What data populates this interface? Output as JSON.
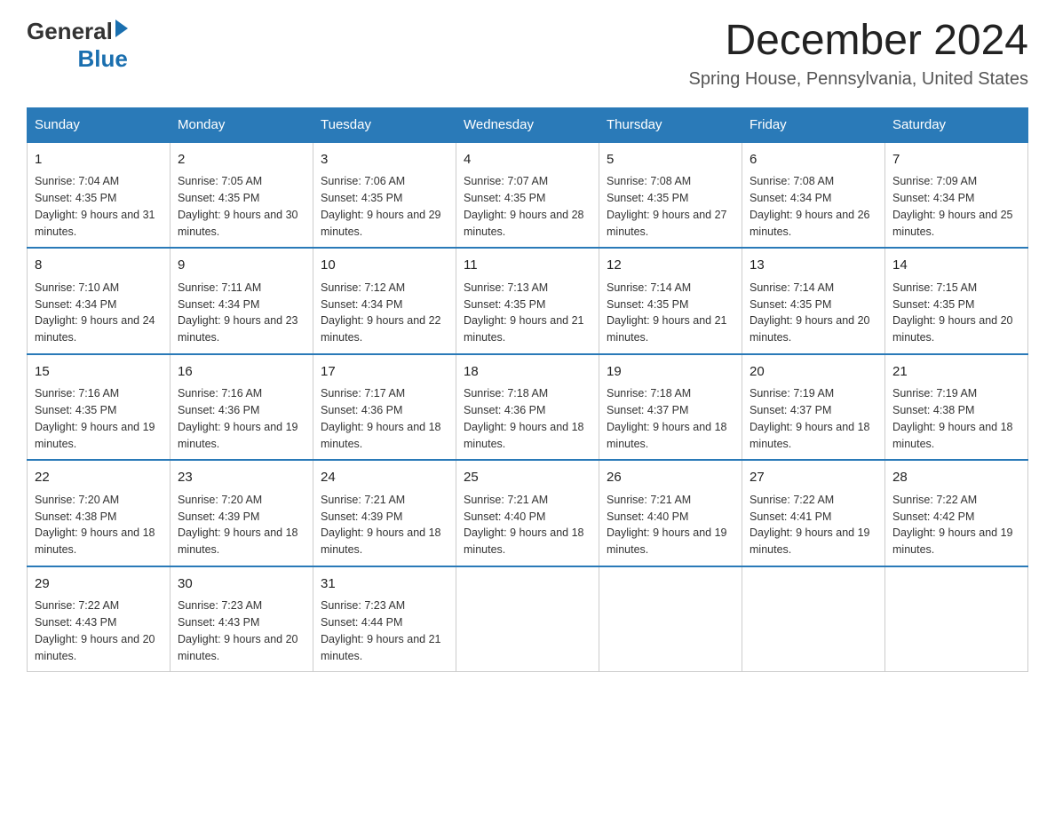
{
  "logo": {
    "general": "General",
    "blue": "Blue"
  },
  "header": {
    "month": "December 2024",
    "location": "Spring House, Pennsylvania, United States"
  },
  "weekdays": [
    "Sunday",
    "Monday",
    "Tuesday",
    "Wednesday",
    "Thursday",
    "Friday",
    "Saturday"
  ],
  "weeks": [
    [
      {
        "day": "1",
        "sunrise": "7:04 AM",
        "sunset": "4:35 PM",
        "daylight": "9 hours and 31 minutes."
      },
      {
        "day": "2",
        "sunrise": "7:05 AM",
        "sunset": "4:35 PM",
        "daylight": "9 hours and 30 minutes."
      },
      {
        "day": "3",
        "sunrise": "7:06 AM",
        "sunset": "4:35 PM",
        "daylight": "9 hours and 29 minutes."
      },
      {
        "day": "4",
        "sunrise": "7:07 AM",
        "sunset": "4:35 PM",
        "daylight": "9 hours and 28 minutes."
      },
      {
        "day": "5",
        "sunrise": "7:08 AM",
        "sunset": "4:35 PM",
        "daylight": "9 hours and 27 minutes."
      },
      {
        "day": "6",
        "sunrise": "7:08 AM",
        "sunset": "4:34 PM",
        "daylight": "9 hours and 26 minutes."
      },
      {
        "day": "7",
        "sunrise": "7:09 AM",
        "sunset": "4:34 PM",
        "daylight": "9 hours and 25 minutes."
      }
    ],
    [
      {
        "day": "8",
        "sunrise": "7:10 AM",
        "sunset": "4:34 PM",
        "daylight": "9 hours and 24 minutes."
      },
      {
        "day": "9",
        "sunrise": "7:11 AM",
        "sunset": "4:34 PM",
        "daylight": "9 hours and 23 minutes."
      },
      {
        "day": "10",
        "sunrise": "7:12 AM",
        "sunset": "4:34 PM",
        "daylight": "9 hours and 22 minutes."
      },
      {
        "day": "11",
        "sunrise": "7:13 AM",
        "sunset": "4:35 PM",
        "daylight": "9 hours and 21 minutes."
      },
      {
        "day": "12",
        "sunrise": "7:14 AM",
        "sunset": "4:35 PM",
        "daylight": "9 hours and 21 minutes."
      },
      {
        "day": "13",
        "sunrise": "7:14 AM",
        "sunset": "4:35 PM",
        "daylight": "9 hours and 20 minutes."
      },
      {
        "day": "14",
        "sunrise": "7:15 AM",
        "sunset": "4:35 PM",
        "daylight": "9 hours and 20 minutes."
      }
    ],
    [
      {
        "day": "15",
        "sunrise": "7:16 AM",
        "sunset": "4:35 PM",
        "daylight": "9 hours and 19 minutes."
      },
      {
        "day": "16",
        "sunrise": "7:16 AM",
        "sunset": "4:36 PM",
        "daylight": "9 hours and 19 minutes."
      },
      {
        "day": "17",
        "sunrise": "7:17 AM",
        "sunset": "4:36 PM",
        "daylight": "9 hours and 18 minutes."
      },
      {
        "day": "18",
        "sunrise": "7:18 AM",
        "sunset": "4:36 PM",
        "daylight": "9 hours and 18 minutes."
      },
      {
        "day": "19",
        "sunrise": "7:18 AM",
        "sunset": "4:37 PM",
        "daylight": "9 hours and 18 minutes."
      },
      {
        "day": "20",
        "sunrise": "7:19 AM",
        "sunset": "4:37 PM",
        "daylight": "9 hours and 18 minutes."
      },
      {
        "day": "21",
        "sunrise": "7:19 AM",
        "sunset": "4:38 PM",
        "daylight": "9 hours and 18 minutes."
      }
    ],
    [
      {
        "day": "22",
        "sunrise": "7:20 AM",
        "sunset": "4:38 PM",
        "daylight": "9 hours and 18 minutes."
      },
      {
        "day": "23",
        "sunrise": "7:20 AM",
        "sunset": "4:39 PM",
        "daylight": "9 hours and 18 minutes."
      },
      {
        "day": "24",
        "sunrise": "7:21 AM",
        "sunset": "4:39 PM",
        "daylight": "9 hours and 18 minutes."
      },
      {
        "day": "25",
        "sunrise": "7:21 AM",
        "sunset": "4:40 PM",
        "daylight": "9 hours and 18 minutes."
      },
      {
        "day": "26",
        "sunrise": "7:21 AM",
        "sunset": "4:40 PM",
        "daylight": "9 hours and 19 minutes."
      },
      {
        "day": "27",
        "sunrise": "7:22 AM",
        "sunset": "4:41 PM",
        "daylight": "9 hours and 19 minutes."
      },
      {
        "day": "28",
        "sunrise": "7:22 AM",
        "sunset": "4:42 PM",
        "daylight": "9 hours and 19 minutes."
      }
    ],
    [
      {
        "day": "29",
        "sunrise": "7:22 AM",
        "sunset": "4:43 PM",
        "daylight": "9 hours and 20 minutes."
      },
      {
        "day": "30",
        "sunrise": "7:23 AM",
        "sunset": "4:43 PM",
        "daylight": "9 hours and 20 minutes."
      },
      {
        "day": "31",
        "sunrise": "7:23 AM",
        "sunset": "4:44 PM",
        "daylight": "9 hours and 21 minutes."
      },
      null,
      null,
      null,
      null
    ]
  ]
}
